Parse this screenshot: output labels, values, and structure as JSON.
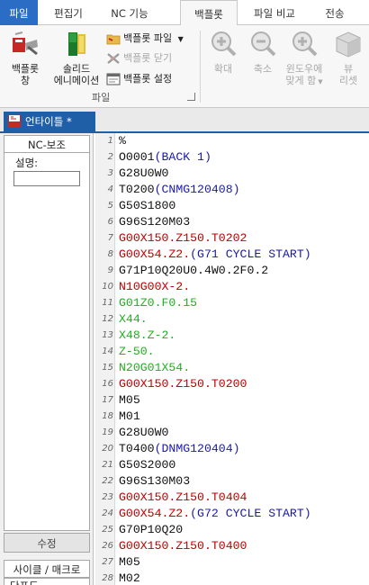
{
  "colors": {
    "file_tab_bg": "#2b6cc4",
    "doc_tab_bg": "#1f5fa8",
    "code_default": "#111111",
    "code_rapid": "#c00000",
    "code_comment": "#1a1aa6",
    "code_feed": "#20b020"
  },
  "ribbon": {
    "tabs": [
      "파일",
      "편집기",
      "NC 기능",
      "백플롯",
      "파일 비교",
      "전송"
    ],
    "active_tab": "백플롯",
    "backplot_window": {
      "line1": "백플롯",
      "line2": "창",
      "icon": "backplot-window-icon"
    },
    "solid_anim": {
      "line1": "솔리드",
      "line2": "에니메이션",
      "icon": "solid-animation-icon"
    },
    "file_menu": {
      "label": "백플롯 파일",
      "icon": "backplot-file-icon"
    },
    "close": {
      "label": "백플롯 닫기",
      "icon": "backplot-close-icon"
    },
    "settings": {
      "label": "백플롯 설정",
      "icon": "backplot-settings-icon"
    },
    "group_label": "파일",
    "zoom_in": {
      "label": "확대",
      "icon": "zoom-in-icon"
    },
    "zoom_out": {
      "label": "축소",
      "icon": "zoom-out-icon"
    },
    "fit_window": {
      "line1": "윈도우에",
      "line2": "맞게 함",
      "icon": "fit-window-icon"
    },
    "view": {
      "line1": "뷰",
      "line2": "리셋",
      "icon": "view-cube-icon"
    }
  },
  "document": {
    "tab_label": "언타이틀 *",
    "tab_icon": "nc-file-icon"
  },
  "left_panel": {
    "header": "NC-보조",
    "description_label": "설명:",
    "description_value": "",
    "edit_button": "수정",
    "cycle_macro": "사이클 / 매크로",
    "cut_off_item": "단포도"
  },
  "editor": {
    "lines": [
      {
        "n": "1",
        "segs": [
          {
            "t": "%",
            "c": "k"
          }
        ]
      },
      {
        "n": "2",
        "segs": [
          {
            "t": "O0001",
            "c": "k"
          },
          {
            "t": "(BACK 1)",
            "c": "b"
          }
        ]
      },
      {
        "n": "3",
        "segs": [
          {
            "t": "G28U0W0",
            "c": "k"
          }
        ]
      },
      {
        "n": "4",
        "segs": [
          {
            "t": "T0200",
            "c": "k"
          },
          {
            "t": "(CNMG120408)",
            "c": "b"
          }
        ]
      },
      {
        "n": "5",
        "segs": [
          {
            "t": "G50S1800",
            "c": "k"
          }
        ]
      },
      {
        "n": "6",
        "segs": [
          {
            "t": "G96S120M03",
            "c": "k"
          }
        ]
      },
      {
        "n": "7",
        "segs": [
          {
            "t": "G00X150.Z150.T0202",
            "c": "r"
          }
        ]
      },
      {
        "n": "8",
        "segs": [
          {
            "t": "G00X54.Z2.",
            "c": "r"
          },
          {
            "t": "(G71 CYCLE START)",
            "c": "b"
          }
        ]
      },
      {
        "n": "9",
        "segs": [
          {
            "t": "G71P10Q20U0.4W0.2F0.2",
            "c": "k"
          }
        ]
      },
      {
        "n": "10",
        "segs": [
          {
            "t": "N10G00X-2.",
            "c": "r"
          }
        ]
      },
      {
        "n": "11",
        "segs": [
          {
            "t": "G01Z0.F0.15",
            "c": "g"
          }
        ]
      },
      {
        "n": "12",
        "segs": [
          {
            "t": "X44.",
            "c": "g"
          }
        ]
      },
      {
        "n": "13",
        "segs": [
          {
            "t": "X48.Z-2.",
            "c": "g"
          }
        ]
      },
      {
        "n": "14",
        "segs": [
          {
            "t": "Z-50.",
            "c": "g"
          }
        ]
      },
      {
        "n": "15",
        "segs": [
          {
            "t": "N20G01X54.",
            "c": "g"
          }
        ]
      },
      {
        "n": "16",
        "segs": [
          {
            "t": "G00X150.Z150.T0200",
            "c": "r"
          }
        ]
      },
      {
        "n": "17",
        "segs": [
          {
            "t": "M05",
            "c": "k"
          }
        ]
      },
      {
        "n": "18",
        "segs": [
          {
            "t": "M01",
            "c": "k"
          }
        ]
      },
      {
        "n": "19",
        "segs": [
          {
            "t": "G28U0W0",
            "c": "k"
          }
        ]
      },
      {
        "n": "20",
        "segs": [
          {
            "t": "T0400",
            "c": "k"
          },
          {
            "t": "(DNMG120404)",
            "c": "b"
          }
        ]
      },
      {
        "n": "21",
        "segs": [
          {
            "t": "G50S2000",
            "c": "k"
          }
        ]
      },
      {
        "n": "22",
        "segs": [
          {
            "t": "G96S130M03",
            "c": "k"
          }
        ]
      },
      {
        "n": "23",
        "segs": [
          {
            "t": "G00X150.Z150.T0404",
            "c": "r"
          }
        ]
      },
      {
        "n": "24",
        "segs": [
          {
            "t": "G00X54.Z2.",
            "c": "r"
          },
          {
            "t": "(G72 CYCLE START)",
            "c": "b"
          }
        ]
      },
      {
        "n": "25",
        "segs": [
          {
            "t": "G70P10Q20",
            "c": "k"
          }
        ]
      },
      {
        "n": "26",
        "segs": [
          {
            "t": "G00X150.Z150.T0400",
            "c": "r"
          }
        ]
      },
      {
        "n": "27",
        "segs": [
          {
            "t": "M05",
            "c": "k"
          }
        ]
      },
      {
        "n": "28",
        "segs": [
          {
            "t": "M02",
            "c": "k"
          }
        ]
      }
    ]
  }
}
